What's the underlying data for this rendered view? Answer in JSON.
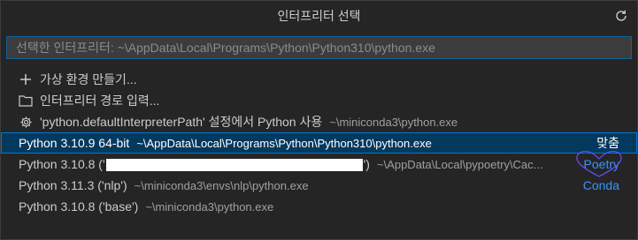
{
  "title": "인터프리터 선택",
  "search": {
    "placeholder": "선택한 인터프리터: ~\\AppData\\Local\\Programs\\Python\\Python310\\python.exe"
  },
  "actions": [
    {
      "label": "가상 환경 만들기...",
      "icon": "plus-icon"
    },
    {
      "label": "인터프리터 경로 입력...",
      "icon": "folder-icon"
    }
  ],
  "setting_item": {
    "label": "'python.defaultInterpreterPath' 설정에서 Python 사용",
    "desc": "~\\miniconda3\\python.exe",
    "icon": "gear-icon"
  },
  "interpreters": [
    {
      "label": "Python 3.10.9 64-bit",
      "desc": "~\\AppData\\Local\\Programs\\Python\\Python310\\python.exe",
      "tag": "맞춤",
      "selected": true
    },
    {
      "label_prefix": "Python 3.10.8 ('",
      "label_suffix": "')",
      "desc": "~\\AppData\\Local\\pypoetry\\Cac...",
      "tag": "Poetry",
      "redacted": true
    },
    {
      "label": "Python 3.11.3 ('nlp')",
      "desc": "~\\miniconda3\\envs\\nlp\\python.exe",
      "tag": "Conda"
    },
    {
      "label": "Python 3.10.8 ('base')",
      "desc": "~\\miniconda3\\python.exe",
      "tag": ""
    }
  ],
  "colors": {
    "background": "#252526",
    "selected_bg": "#04395e",
    "focus_border": "#0078d4",
    "tag_blue": "#3794ff",
    "annotation_heart": "#6a4cff"
  }
}
